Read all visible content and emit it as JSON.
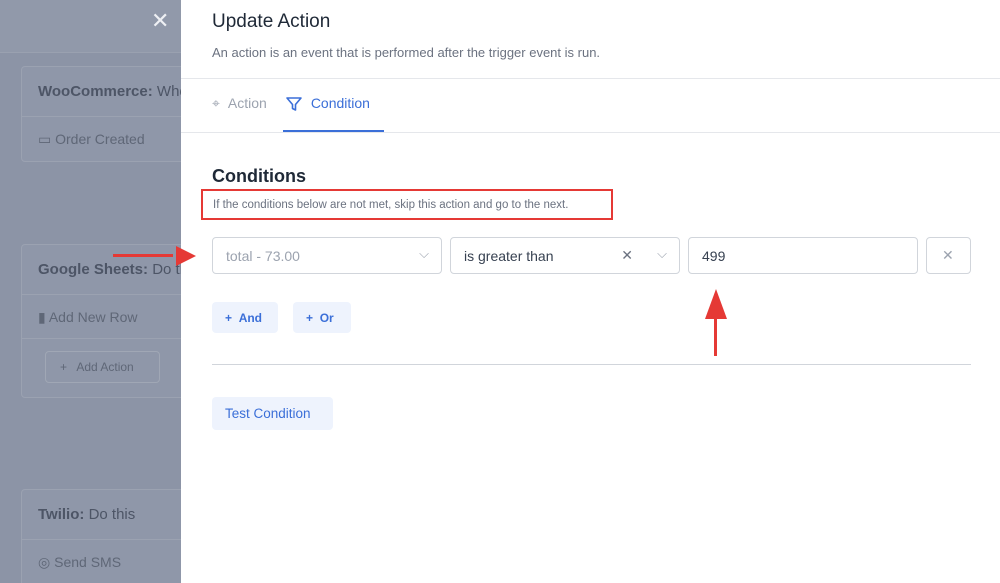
{
  "background": {
    "cards": [
      {
        "app": "WooCommerce:",
        "desc": "When this happens",
        "rows": [
          "Order Created"
        ]
      },
      {
        "app": "Google Sheets:",
        "desc": "Do this",
        "rows": [
          "Add New Row"
        ],
        "add_action": "Add Action"
      },
      {
        "app": "Twilio:",
        "desc": "Do this",
        "rows": [
          "Send SMS"
        ]
      }
    ]
  },
  "panel": {
    "title": "Update Action",
    "subtitle": "An action is an event that is performed after the trigger event is run.",
    "tabs": [
      {
        "label": "Action",
        "icon": "pointer-click-icon"
      },
      {
        "label": "Condition",
        "icon": "filter-icon",
        "active": true
      }
    ],
    "conditions_title": "Conditions",
    "conditions_note": "If the conditions below are not met, skip this action and go to the next.",
    "field": "total - 73.00",
    "operator": "is greater than",
    "value": "499",
    "and_label": "And",
    "or_label": "Or",
    "test_label": "Test Condition"
  },
  "colors": {
    "accent": "#3b6fd8",
    "annotation": "#e53935"
  }
}
